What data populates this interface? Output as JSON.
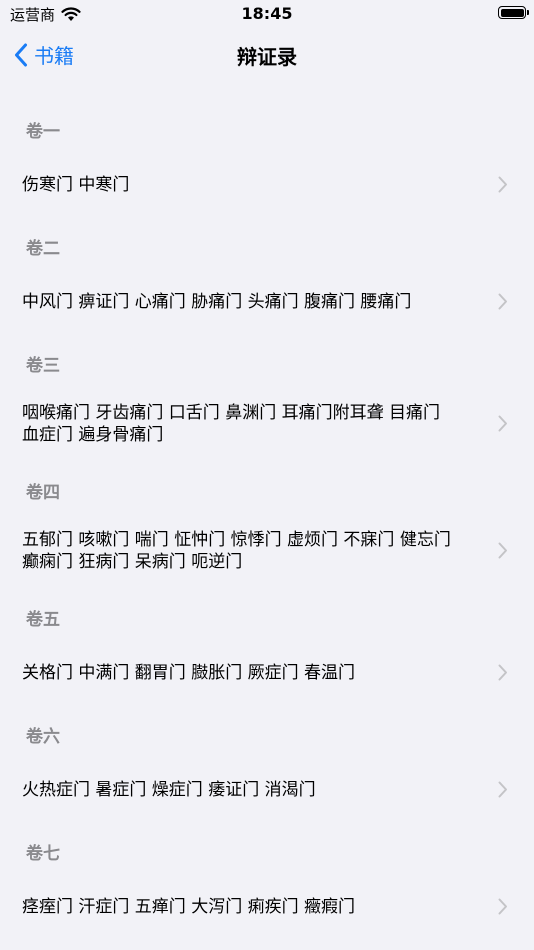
{
  "status": {
    "carrier": "运营商",
    "time": "18:45"
  },
  "nav": {
    "back_label": "书籍",
    "title": "辩证录"
  },
  "sections": [
    {
      "header": "卷一",
      "item": "伤寒门 中寒门"
    },
    {
      "header": "卷二",
      "item": "中风门 痹证门 心痛门 胁痛门 头痛门 腹痛门 腰痛门"
    },
    {
      "header": "卷三",
      "item": "咽喉痛门 牙齿痛门 口舌门 鼻渊门 耳痛门附耳聋 目痛门 血症门 遍身骨痛门"
    },
    {
      "header": "卷四",
      "item": "五郁门 咳嗽门 喘门 怔忡门 惊悸门 虚烦门 不寐门 健忘门 癫痫门 狂病门 呆病门 呃逆门"
    },
    {
      "header": "卷五",
      "item": "关格门 中满门 翻胃门 臌胀门 厥症门 春温门"
    },
    {
      "header": "卷六",
      "item": "火热症门 暑症门 燥症门 痿证门 消渴门"
    },
    {
      "header": "卷七",
      "item": "痉痓门 汗症门 五瘅门 大泻门 痢疾门 癥瘕门"
    }
  ],
  "icons": {
    "wifi": "wifi-icon",
    "battery": "battery-icon",
    "back": "chevron-left-icon",
    "disclosure": "chevron-right-icon"
  },
  "colors": {
    "accent": "#1a7cf5",
    "background": "#f2f2f7",
    "section_header": "#8a8a8e",
    "chevron": "#c4c4c7"
  }
}
